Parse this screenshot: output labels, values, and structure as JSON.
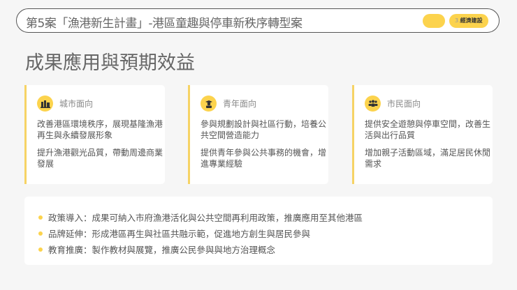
{
  "header": {
    "title": "第5案「漁港新生計畫」-港區童趣與停車新秩序轉型案",
    "section_number": "3.",
    "section_label": "經濟建設"
  },
  "page_title": "成果應用與預期效益",
  "cards": [
    {
      "icon": "city-buildings-icon",
      "title": "城市面向",
      "p1": "改善港區環境秩序，展現基隆漁港再生與永續發展形象",
      "p2": "提升漁港觀光品質，帶動周邊商業發展"
    },
    {
      "icon": "graduate-icon",
      "title": "青年面向",
      "p1": "參與規劃設計與社區行動，培養公共空間營造能力",
      "p2": "提供青年參與公共事務的機會，增進專業經驗"
    },
    {
      "icon": "people-group-icon",
      "title": "市民面向",
      "p1": "提供安全遊憩與停車空間，改善生活與出行品質",
      "p2": "增加親子活動區域，滿足居民休閒需求"
    }
  ],
  "bullets": [
    "政策導入：成果可納入市府漁港活化與公共空間再利用政策，推廣應用至其他港區",
    "品牌延伸：形成港區再生與社區共融示範，促進地方創生與居民參與",
    "教育推廣：製作教材與展覽，推廣公民參與與地方治理概念"
  ],
  "colors": {
    "accent": "#fcd34d",
    "text": "#555555"
  }
}
